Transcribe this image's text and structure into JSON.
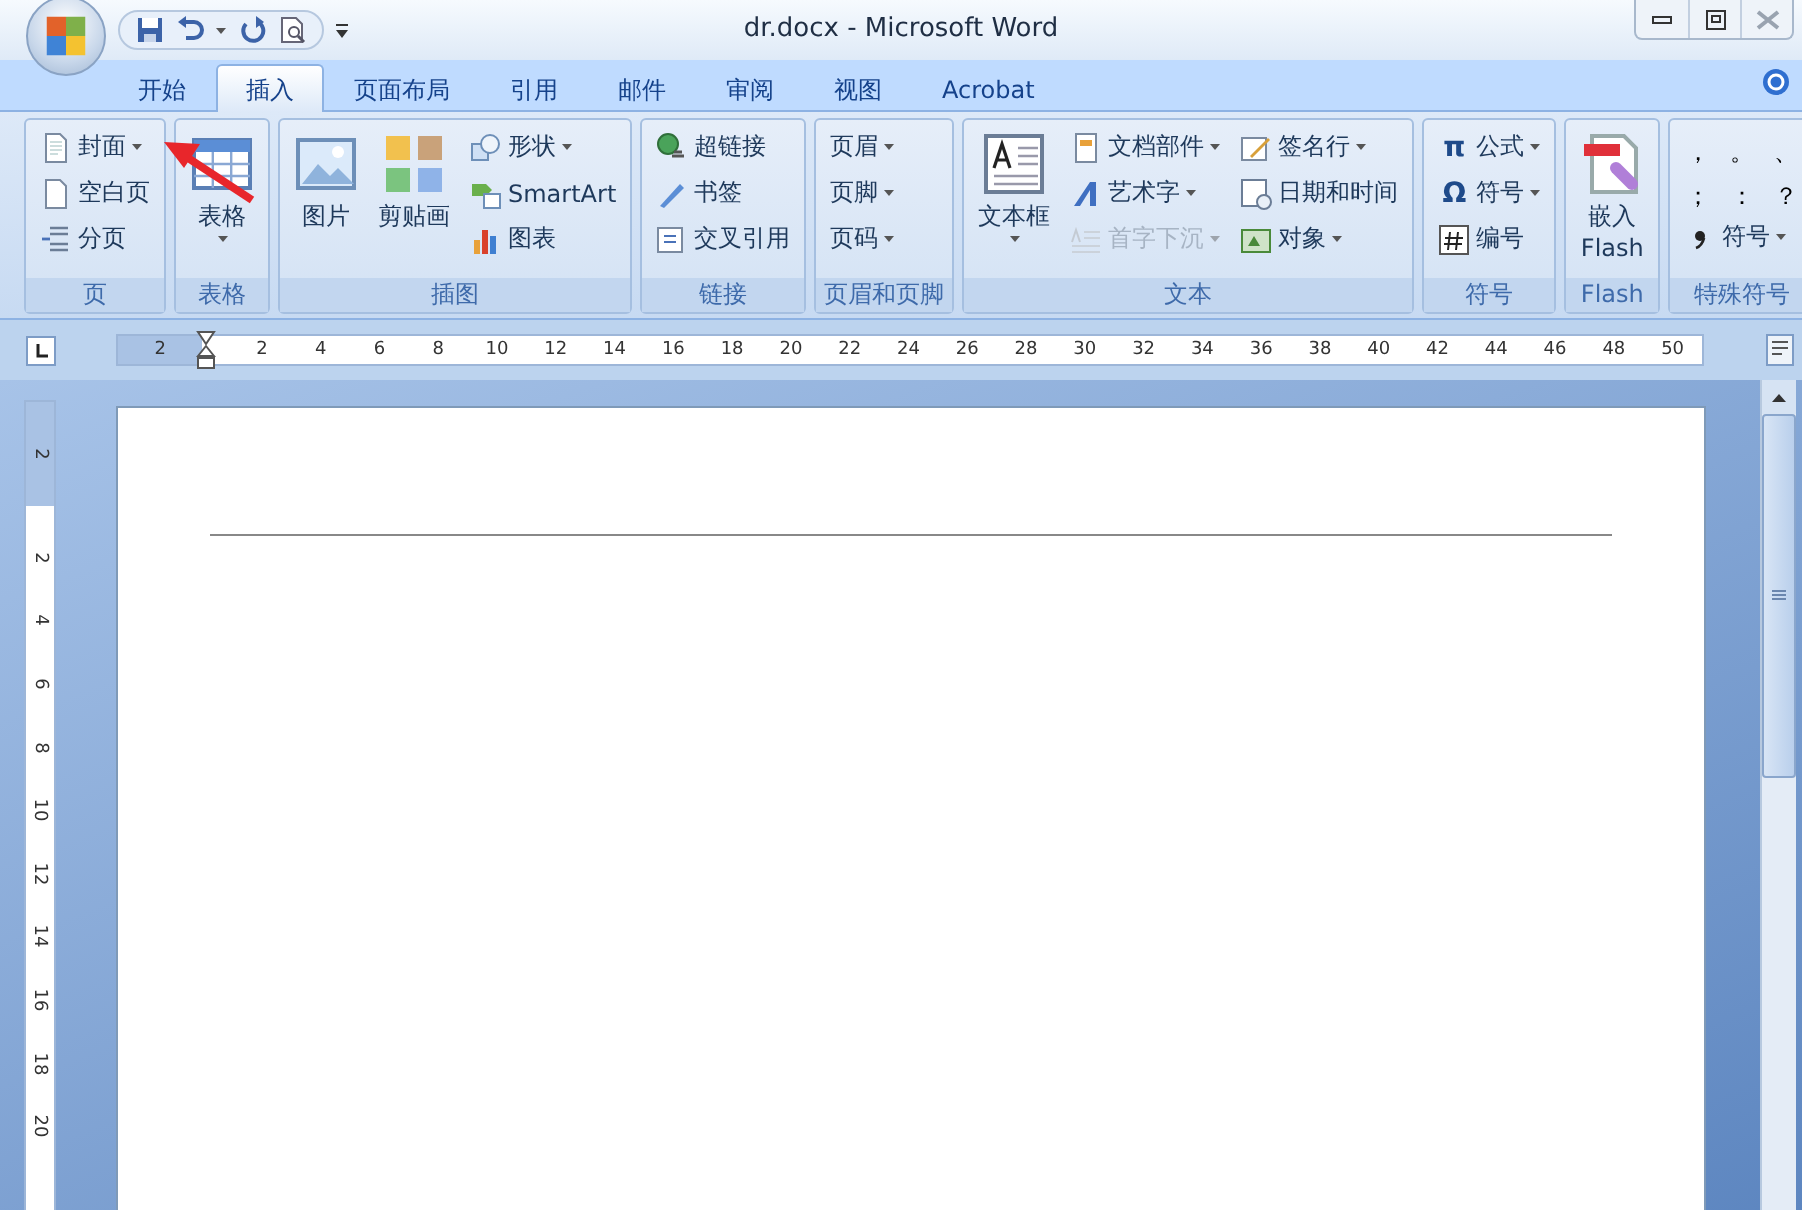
{
  "window": {
    "title": "dr.docx - Microsoft Word"
  },
  "tabs": [
    {
      "label": "开始",
      "selected": false
    },
    {
      "label": "插入",
      "selected": true
    },
    {
      "label": "页面布局",
      "selected": false
    },
    {
      "label": "引用",
      "selected": false
    },
    {
      "label": "邮件",
      "selected": false
    },
    {
      "label": "审阅",
      "selected": false
    },
    {
      "label": "视图",
      "selected": false
    },
    {
      "label": "Acrobat",
      "selected": false
    }
  ],
  "ribbon": {
    "groups": [
      {
        "label": "页",
        "kind": "columns",
        "columns": [
          [
            {
              "kind": "small",
              "label": "封面",
              "dropdown": true,
              "disabled": false
            },
            {
              "kind": "small",
              "label": "空白页",
              "dropdown": false,
              "disabled": false
            },
            {
              "kind": "small",
              "label": "分页",
              "dropdown": false,
              "disabled": false
            }
          ]
        ]
      },
      {
        "label": "表格",
        "kind": "columns",
        "columns": [
          [
            {
              "kind": "large",
              "label": "表格",
              "dropdown": true,
              "disabled": false
            }
          ]
        ]
      },
      {
        "label": "插图",
        "kind": "columns",
        "columns": [
          [
            {
              "kind": "large",
              "label": "图片",
              "dropdown": false,
              "disabled": false
            }
          ],
          [
            {
              "kind": "large",
              "label": "剪贴画",
              "dropdown": false,
              "disabled": false
            }
          ],
          [
            {
              "kind": "small",
              "label": "形状",
              "dropdown": true,
              "disabled": false
            },
            {
              "kind": "small",
              "label": "SmartArt",
              "dropdown": false,
              "disabled": false
            },
            {
              "kind": "small",
              "label": "图表",
              "dropdown": false,
              "disabled": false
            }
          ]
        ]
      },
      {
        "label": "链接",
        "kind": "columns",
        "columns": [
          [
            {
              "kind": "small",
              "label": "超链接",
              "dropdown": false,
              "disabled": false
            },
            {
              "kind": "small",
              "label": "书签",
              "dropdown": false,
              "disabled": false
            },
            {
              "kind": "small",
              "label": "交叉引用",
              "dropdown": false,
              "disabled": false
            }
          ]
        ]
      },
      {
        "label": "页眉和页脚",
        "kind": "columns",
        "columns": [
          [
            {
              "kind": "small",
              "label": "页眉",
              "dropdown": true,
              "disabled": false
            },
            {
              "kind": "small",
              "label": "页脚",
              "dropdown": true,
              "disabled": false
            },
            {
              "kind": "small",
              "label": "页码",
              "dropdown": true,
              "disabled": false
            }
          ]
        ]
      },
      {
        "label": "文本",
        "kind": "columns",
        "columns": [
          [
            {
              "kind": "large",
              "label": "文本框",
              "dropdown": true,
              "disabled": false
            }
          ],
          [
            {
              "kind": "small",
              "label": "文档部件",
              "dropdown": true,
              "disabled": false
            },
            {
              "kind": "small",
              "label": "艺术字",
              "dropdown": true,
              "disabled": false
            },
            {
              "kind": "small",
              "label": "首字下沉",
              "dropdown": true,
              "disabled": true
            }
          ],
          [
            {
              "kind": "small",
              "label": "签名行",
              "dropdown": true,
              "disabled": false
            },
            {
              "kind": "small",
              "label": "日期和时间",
              "dropdown": false,
              "disabled": false
            },
            {
              "kind": "small",
              "label": "对象",
              "dropdown": true,
              "disabled": false
            }
          ]
        ]
      },
      {
        "label": "符号",
        "kind": "columns",
        "columns": [
          [
            {
              "kind": "small",
              "glyph": "π",
              "label": "公式",
              "dropdown": true,
              "disabled": false
            },
            {
              "kind": "small",
              "glyph": "Ω",
              "label": "符号",
              "dropdown": true,
              "disabled": false
            },
            {
              "kind": "small",
              "label": "编号",
              "dropdown": false,
              "disabled": false
            }
          ]
        ]
      },
      {
        "label": "Flash",
        "kind": "columns",
        "columns": [
          [
            {
              "kind": "large",
              "label": "嵌入 Flash",
              "dropdown": false,
              "disabled": false
            }
          ]
        ]
      },
      {
        "label": "特殊符号",
        "kind": "symbols",
        "symbols": [
          "，",
          "。",
          "、",
          "；",
          "：",
          "？"
        ],
        "items": [
          {
            "kind": "small",
            "label": "符号",
            "dropdown": true,
            "disabled": false
          }
        ]
      }
    ]
  },
  "ruler": {
    "horizontal": [
      "2",
      "2",
      "4",
      "6",
      "8",
      "10",
      "12",
      "14",
      "16",
      "18",
      "20",
      "22",
      "24",
      "26",
      "28",
      "30",
      "32",
      "34",
      "36",
      "38",
      "40",
      "42",
      "44",
      "46",
      "48",
      "50"
    ],
    "vertical": [
      "2",
      "2",
      "4",
      "6",
      "8",
      "10",
      "12",
      "14",
      "16",
      "18",
      "20"
    ]
  }
}
